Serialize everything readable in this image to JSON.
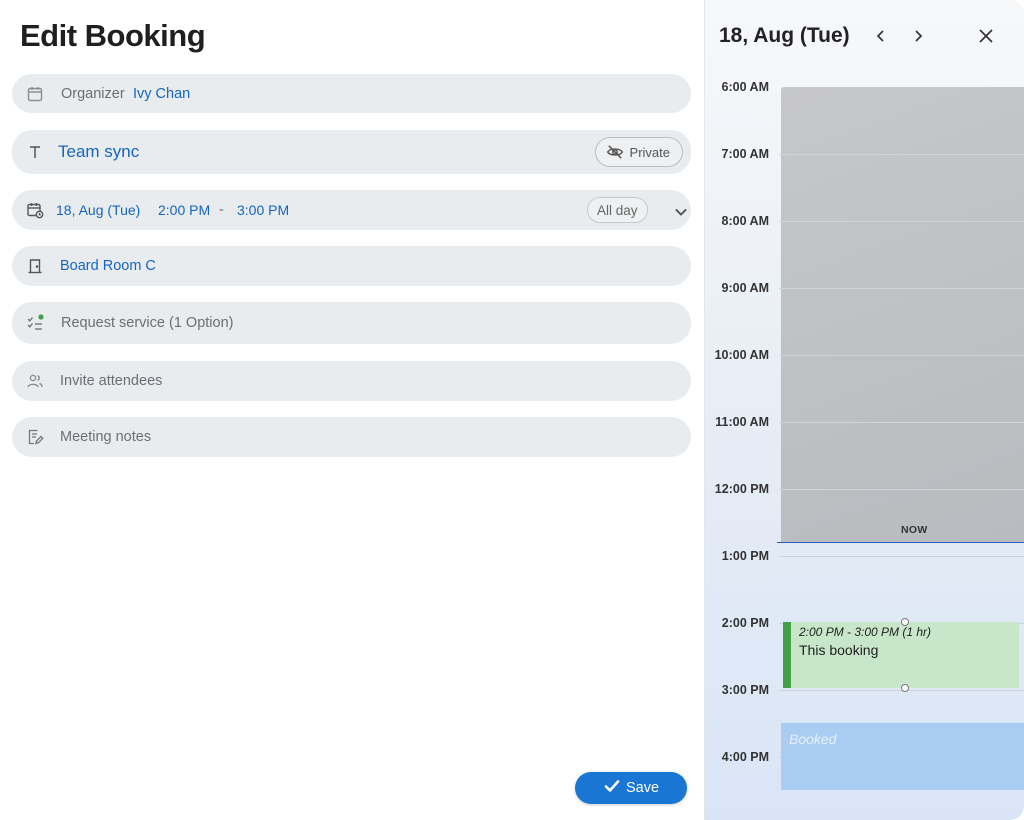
{
  "dialog": {
    "title": "Edit Booking",
    "organizer": {
      "label": "Organizer",
      "value": "Ivy Chan"
    },
    "meeting_title": {
      "value": "Team sync",
      "privacy_button": "Private"
    },
    "schedule": {
      "date": "18, Aug (Tue)",
      "start_time": "2:00 PM",
      "separator": "-",
      "end_time": "3:00 PM",
      "all_day_button": "All day"
    },
    "room": {
      "value": "Board Room C"
    },
    "service": {
      "label": "Request service (1 Option)",
      "status_dot_color": "#43a047"
    },
    "attendees": {
      "placeholder": "Invite attendees"
    },
    "notes": {
      "placeholder": "Meeting notes"
    },
    "save_button": "Save",
    "icons": {
      "organizer": "calendar-icon",
      "title": "text-t-icon",
      "schedule": "calendar-clock-icon",
      "room": "door-icon",
      "service": "checklist-icon",
      "attendees": "people-icon",
      "notes": "note-edit-icon",
      "private": "eye-off-icon",
      "expand": "chevron-down-icon",
      "save": "check-icon"
    }
  },
  "calendar": {
    "date_header": "18, Aug (Tue)",
    "hours": [
      "6:00 AM",
      "7:00 AM",
      "8:00 AM",
      "9:00 AM",
      "10:00 AM",
      "11:00 AM",
      "12:00 PM",
      "1:00 PM",
      "2:00 PM",
      "3:00 PM",
      "4:00 PM"
    ],
    "now_label": "NOW",
    "current_booking": {
      "time": "2:00 PM - 3:00 PM (1 hr)",
      "title": "This booking"
    },
    "booked_block": {
      "label": "Booked"
    },
    "colors": {
      "accent": "#1976d2",
      "link": "#1565c0",
      "booking_bar": "#43a047",
      "booking_fill": "#c8e6c9",
      "booked_fill": "#a9ccf2"
    }
  }
}
